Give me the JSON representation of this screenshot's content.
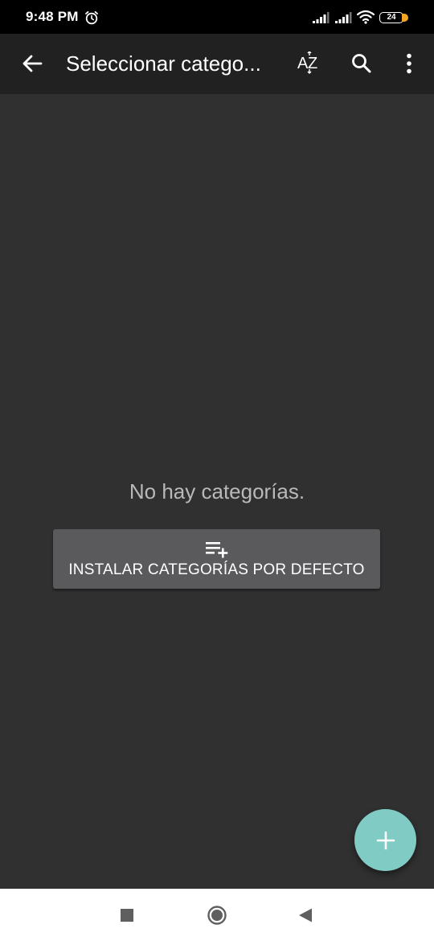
{
  "status_bar": {
    "time": "9:48 PM",
    "battery_level": "24",
    "icons": [
      "alarm-icon",
      "signal-icon",
      "signal-icon",
      "wifi-icon",
      "battery-icon"
    ]
  },
  "app_bar": {
    "title": "Seleccionar catego...",
    "back_icon": "arrow-back-icon",
    "actions": [
      "sort-az-icon",
      "search-icon",
      "more-vert-icon"
    ]
  },
  "content": {
    "empty_message": "No hay categorías.",
    "install_button": {
      "label": "INSTALAR CATEGORÍAS POR DEFECTO",
      "icon": "playlist-add-icon"
    }
  },
  "fab": {
    "icon": "add-icon"
  },
  "nav_bar": {
    "buttons": [
      "recents-square-icon",
      "home-circle-icon",
      "back-triangle-icon"
    ]
  },
  "colors": {
    "status_bar_bg": "#000000",
    "app_bar_bg": "#212121",
    "content_bg": "#303030",
    "button_bg": "#5a5a5c",
    "fab_bg": "#80cbc4",
    "nav_bar_bg": "#ffffff",
    "battery_accent": "#f5a623"
  }
}
